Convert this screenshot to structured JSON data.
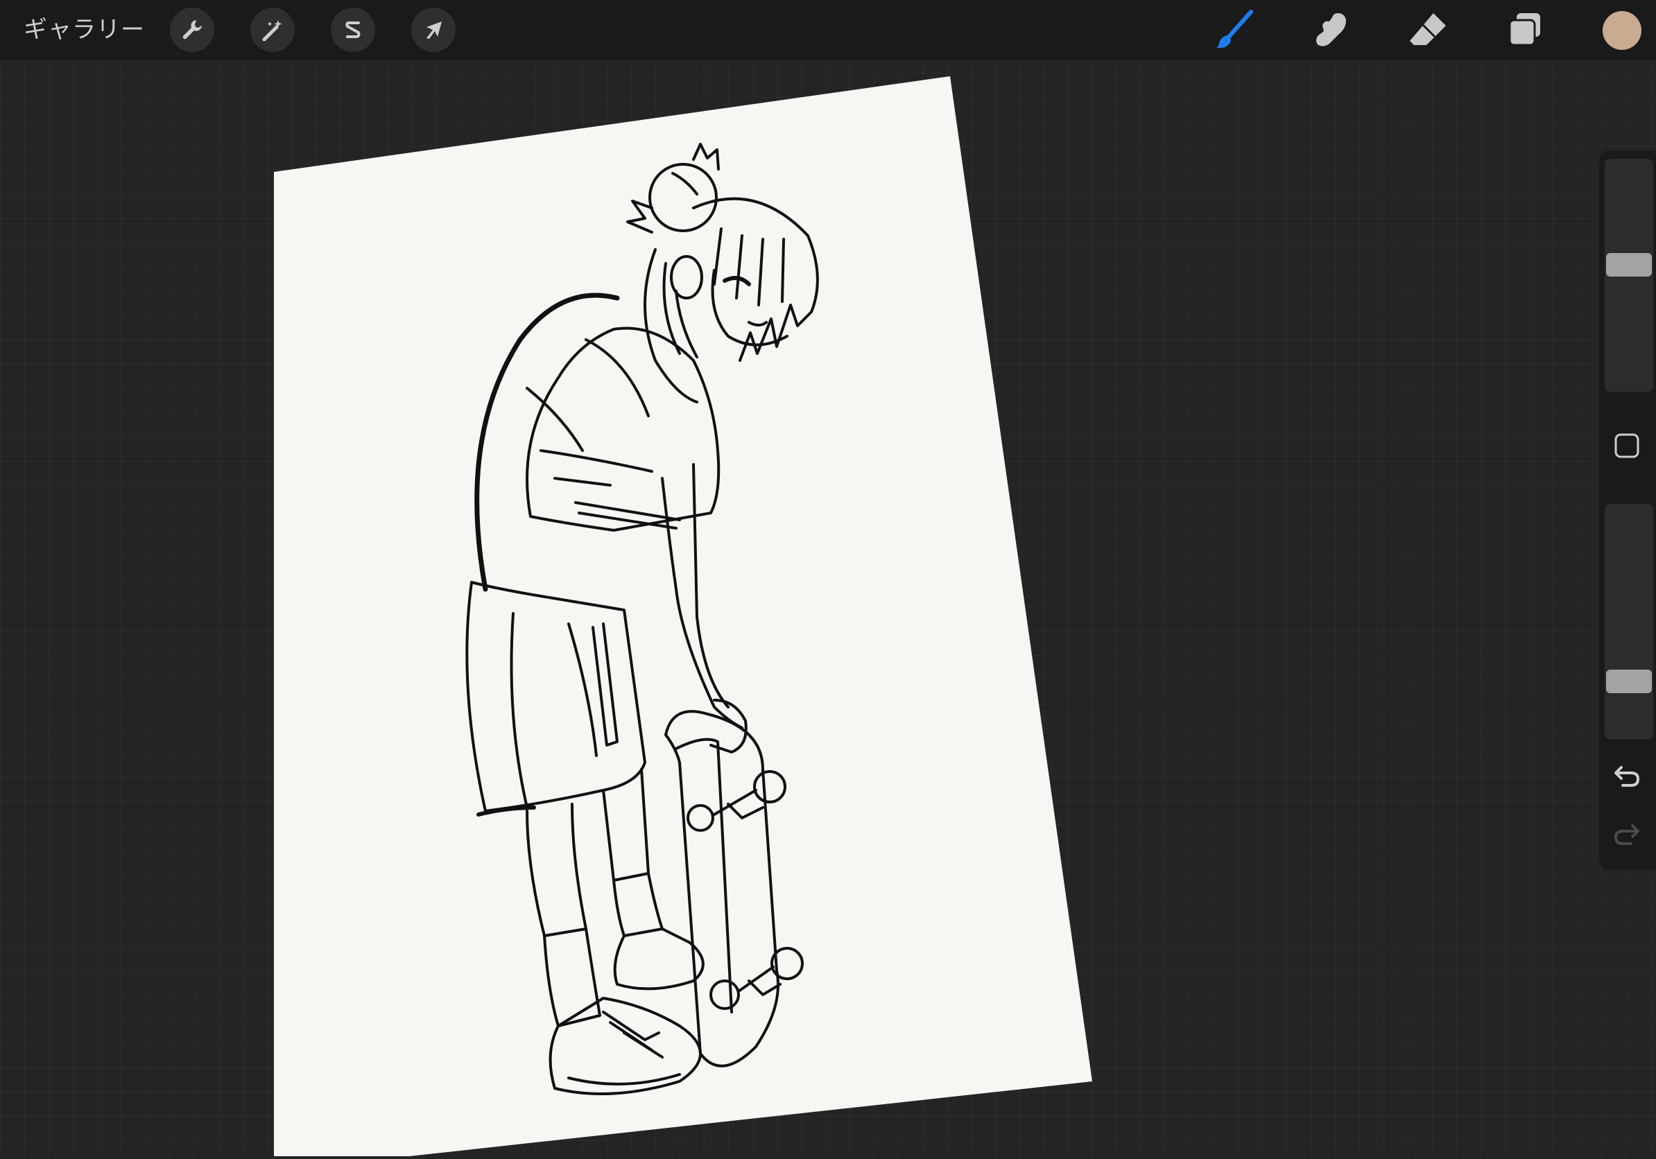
{
  "topbar": {
    "gallery_label": "ギャラリー",
    "actions": [
      {
        "name": "actions-button",
        "icon": "wrench-icon"
      },
      {
        "name": "adjustments-button",
        "icon": "magic-wand-icon"
      },
      {
        "name": "selection-button",
        "icon": "selection-s-icon"
      },
      {
        "name": "transform-button",
        "icon": "arrow-cursor-icon"
      }
    ],
    "tools": [
      {
        "name": "brush-tool",
        "icon": "brush-icon",
        "active": true
      },
      {
        "name": "smudge-tool",
        "icon": "smudge-finger-icon",
        "active": false
      },
      {
        "name": "eraser-tool",
        "icon": "eraser-icon",
        "active": false
      },
      {
        "name": "layers-button",
        "icon": "layers-icon",
        "active": false
      }
    ],
    "color_swatch": "#c9ab92"
  },
  "colors": {
    "active_tool": "#1e7cf2",
    "inactive_tool": "#c8c8c8",
    "paper": "#f8f6f3",
    "ink": "#111111"
  },
  "sidebar": {
    "brush_size_level": 0.45,
    "opacity_level": 0.78,
    "modify_icon": "square-icon",
    "undo_icon": "undo-arrow-icon",
    "redo_icon": "redo-arrow-icon"
  },
  "artwork": {
    "subject_icon": "girl-with-skateboard-lineart"
  }
}
